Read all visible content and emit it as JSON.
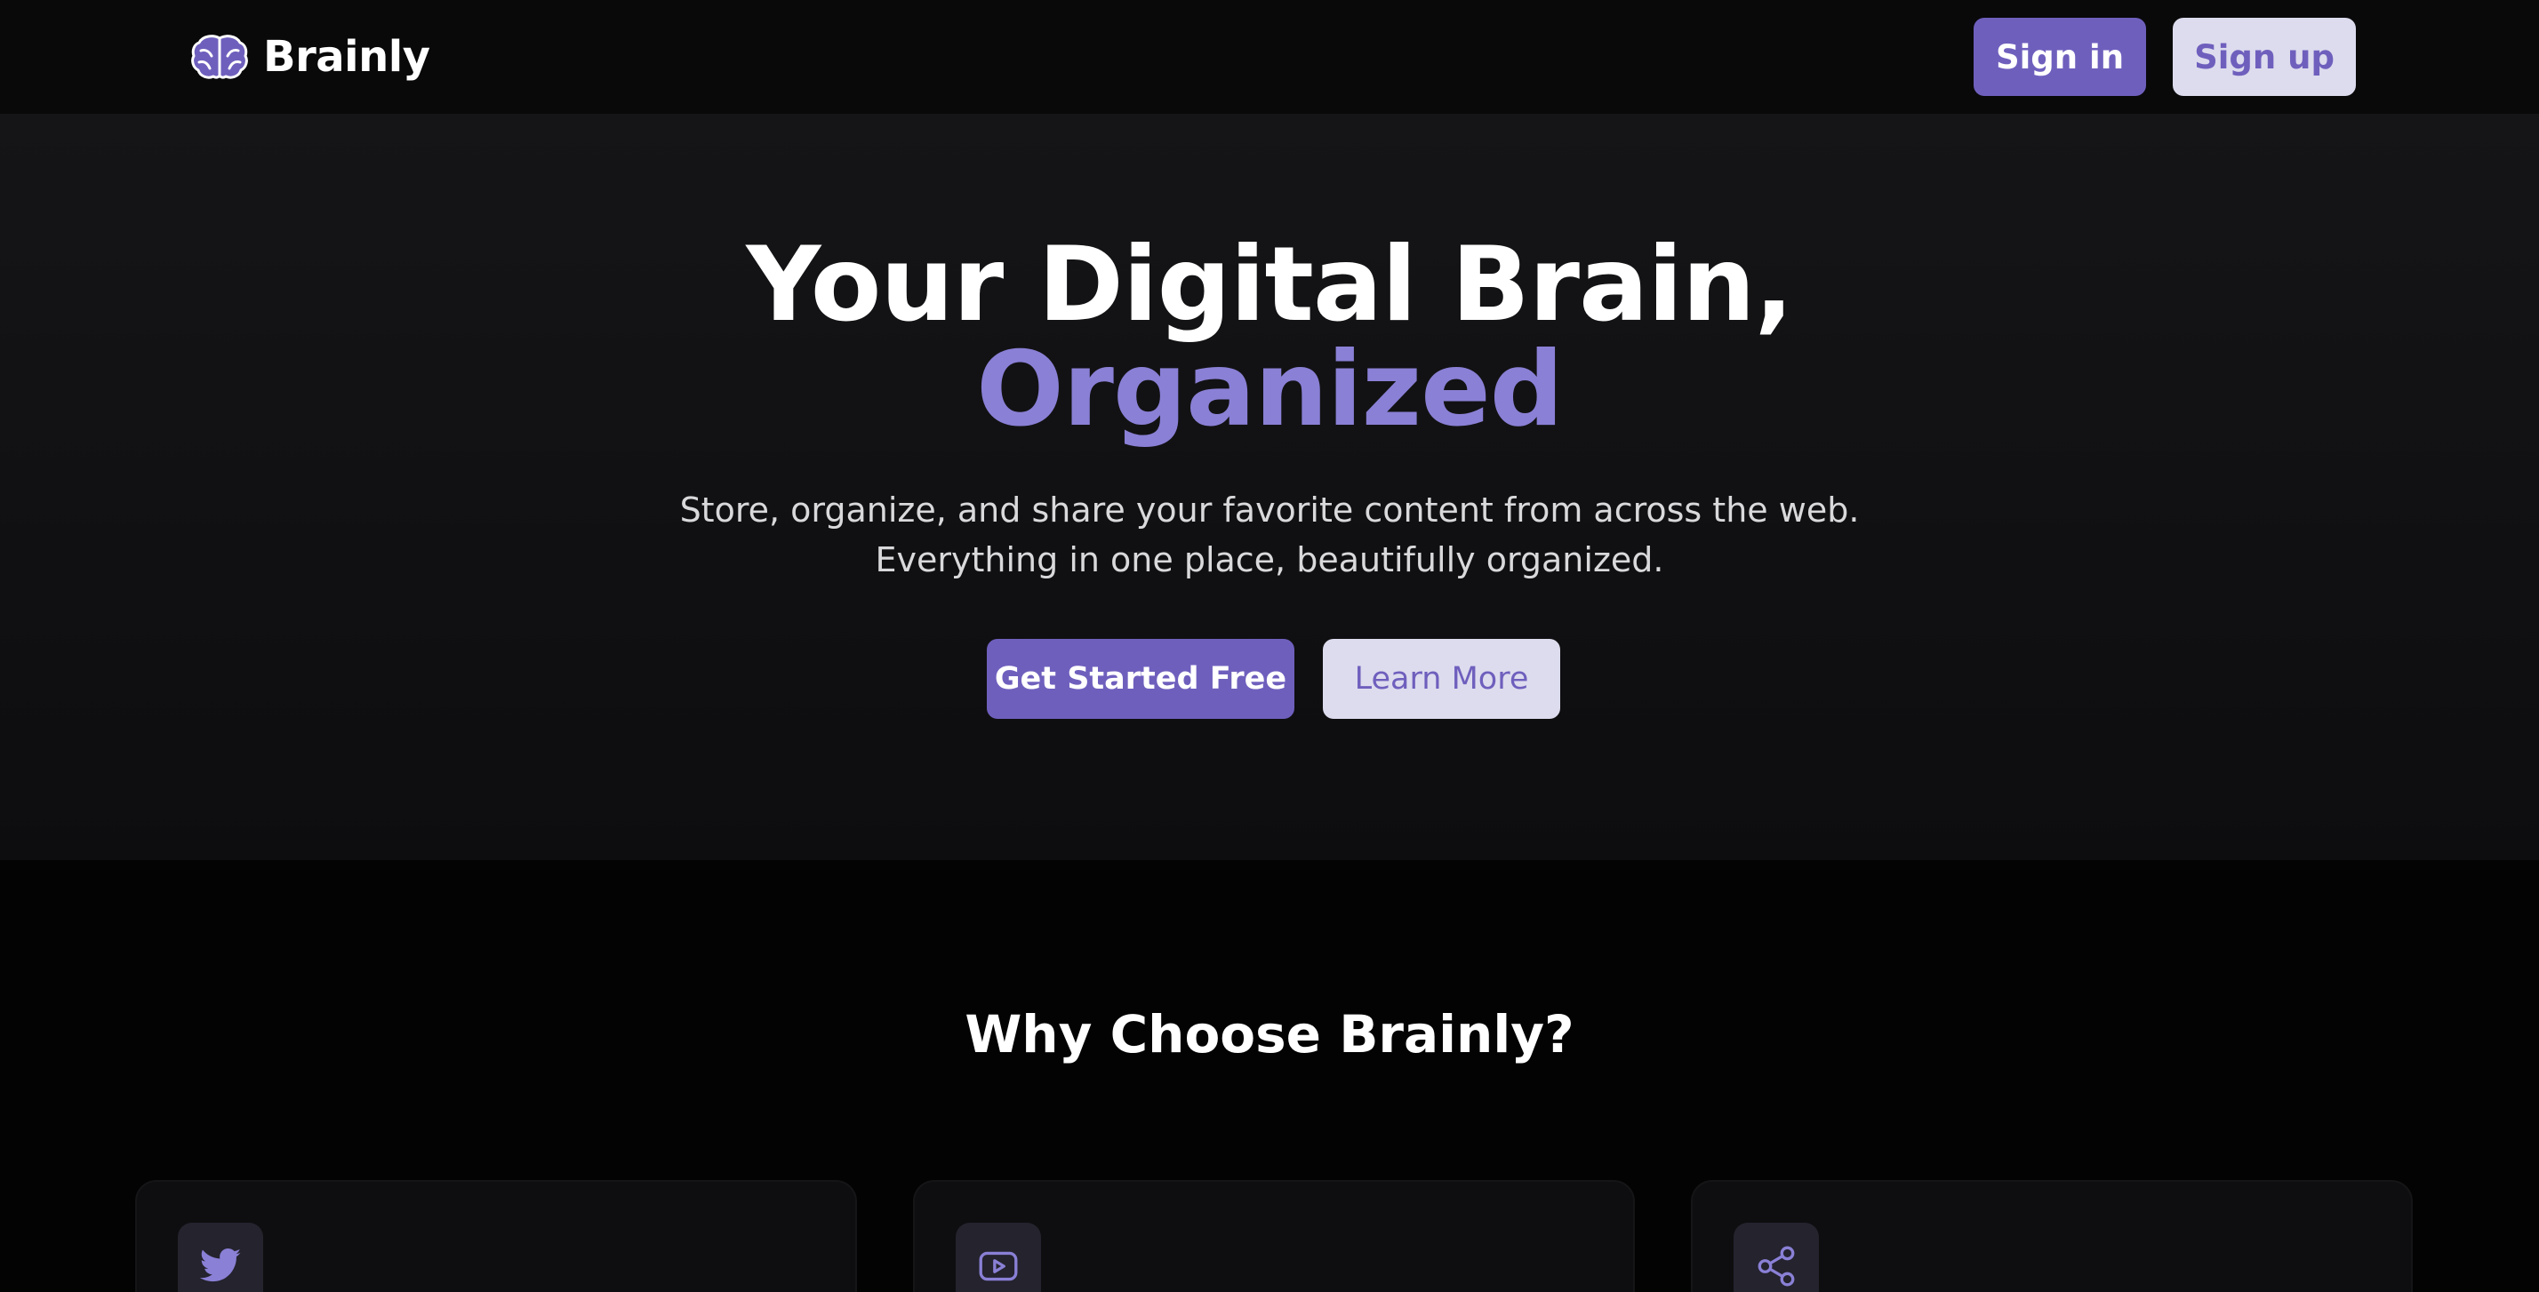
{
  "navbar": {
    "brand": "Brainly",
    "logo_icon": "brain-icon",
    "signin_label": "Sign in",
    "signup_label": "Sign up"
  },
  "hero": {
    "title_line1": "Your Digital Brain,",
    "title_line2": "Organized",
    "subtitle_line1": "Store, organize, and share your favorite content from across the web.",
    "subtitle_line2": "Everything in one place, beautifully organized.",
    "cta_primary": "Get Started Free",
    "cta_secondary": "Learn More"
  },
  "features": {
    "title": "Why Choose Brainly?",
    "cards": [
      {
        "icon": "twitter-icon"
      },
      {
        "icon": "youtube-icon"
      },
      {
        "icon": "share-icon"
      }
    ]
  },
  "colors": {
    "accent": "#6f5fbd",
    "accent_light": "#8a80d6",
    "button_light": "#dcdcee",
    "background": "#030303"
  }
}
